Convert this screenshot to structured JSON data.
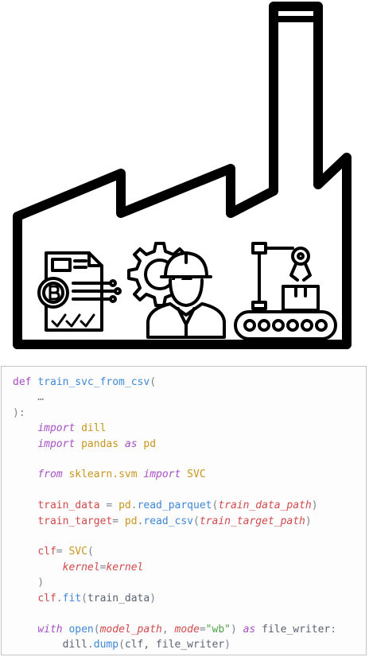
{
  "illustration": {
    "icons": [
      "bitcoin-document-icon",
      "gear-engineer-icon",
      "robot-arm-conveyor-icon"
    ],
    "colors": {
      "stroke": "#000000",
      "background": "#ffffff"
    }
  },
  "code": {
    "lines": [
      [
        {
          "t": "def ",
          "c": "kw"
        },
        {
          "t": "train_svc_from_csv",
          "c": "fn"
        },
        {
          "t": "(",
          "c": "pun"
        }
      ],
      [
        {
          "t": "    …",
          "c": "pun"
        }
      ],
      [
        {
          "t": "):",
          "c": "pun"
        }
      ],
      [
        {
          "t": "    ",
          "c": "plain"
        },
        {
          "t": "import",
          "c": "ikw"
        },
        {
          "t": " dill",
          "c": "mod"
        }
      ],
      [
        {
          "t": "    ",
          "c": "plain"
        },
        {
          "t": "import",
          "c": "ikw"
        },
        {
          "t": " pandas ",
          "c": "mod"
        },
        {
          "t": "as",
          "c": "ikw"
        },
        {
          "t": " pd",
          "c": "mod"
        }
      ],
      [],
      [
        {
          "t": "    ",
          "c": "plain"
        },
        {
          "t": "from",
          "c": "ikw"
        },
        {
          "t": " sklearn.svm ",
          "c": "mod"
        },
        {
          "t": "import",
          "c": "ikw"
        },
        {
          "t": " SVC",
          "c": "mod"
        }
      ],
      [],
      [
        {
          "t": "    ",
          "c": "plain"
        },
        {
          "t": "train_data",
          "c": "var"
        },
        {
          "t": " = ",
          "c": "pun"
        },
        {
          "t": "pd",
          "c": "mod"
        },
        {
          "t": ".",
          "c": "pun"
        },
        {
          "t": "read_parquet",
          "c": "fn"
        },
        {
          "t": "(",
          "c": "pun"
        },
        {
          "t": "train_data_path",
          "c": "param"
        },
        {
          "t": ")",
          "c": "pun"
        }
      ],
      [
        {
          "t": "    ",
          "c": "plain"
        },
        {
          "t": "train_target",
          "c": "var"
        },
        {
          "t": "= ",
          "c": "pun"
        },
        {
          "t": "pd",
          "c": "mod"
        },
        {
          "t": ".",
          "c": "pun"
        },
        {
          "t": "read_csv",
          "c": "fn"
        },
        {
          "t": "(",
          "c": "pun"
        },
        {
          "t": "train_target_path",
          "c": "param"
        },
        {
          "t": ")",
          "c": "pun"
        }
      ],
      [],
      [
        {
          "t": "    ",
          "c": "plain"
        },
        {
          "t": "clf",
          "c": "var"
        },
        {
          "t": "= ",
          "c": "pun"
        },
        {
          "t": "SVC",
          "c": "mod"
        },
        {
          "t": "(",
          "c": "pun"
        }
      ],
      [
        {
          "t": "        ",
          "c": "plain"
        },
        {
          "t": "kernel",
          "c": "param"
        },
        {
          "t": "=",
          "c": "pun"
        },
        {
          "t": "kernel",
          "c": "param"
        }
      ],
      [
        {
          "t": "    )",
          "c": "pun"
        }
      ],
      [
        {
          "t": "    ",
          "c": "plain"
        },
        {
          "t": "clf",
          "c": "var"
        },
        {
          "t": ".",
          "c": "pun"
        },
        {
          "t": "fit",
          "c": "fn"
        },
        {
          "t": "(",
          "c": "pun"
        },
        {
          "t": "train_data",
          "c": "plain"
        },
        {
          "t": ")",
          "c": "pun"
        }
      ],
      [],
      [
        {
          "t": "    ",
          "c": "plain"
        },
        {
          "t": "with",
          "c": "ikw"
        },
        {
          "t": " ",
          "c": "plain"
        },
        {
          "t": "open",
          "c": "fn"
        },
        {
          "t": "(",
          "c": "pun"
        },
        {
          "t": "model_path",
          "c": "param"
        },
        {
          "t": ", ",
          "c": "pun"
        },
        {
          "t": "mode",
          "c": "param"
        },
        {
          "t": "=",
          "c": "pun"
        },
        {
          "t": "\"wb\"",
          "c": "str"
        },
        {
          "t": ") ",
          "c": "pun"
        },
        {
          "t": "as",
          "c": "ikw"
        },
        {
          "t": " file_writer",
          "c": "plain"
        },
        {
          "t": ":",
          "c": "pun"
        }
      ],
      [
        {
          "t": "        ",
          "c": "plain"
        },
        {
          "t": "dill",
          "c": "plain"
        },
        {
          "t": ".",
          "c": "pun"
        },
        {
          "t": "dump",
          "c": "fn"
        },
        {
          "t": "(",
          "c": "pun"
        },
        {
          "t": "clf, file_writer",
          "c": "plain"
        },
        {
          "t": ")",
          "c": "pun"
        }
      ]
    ]
  }
}
